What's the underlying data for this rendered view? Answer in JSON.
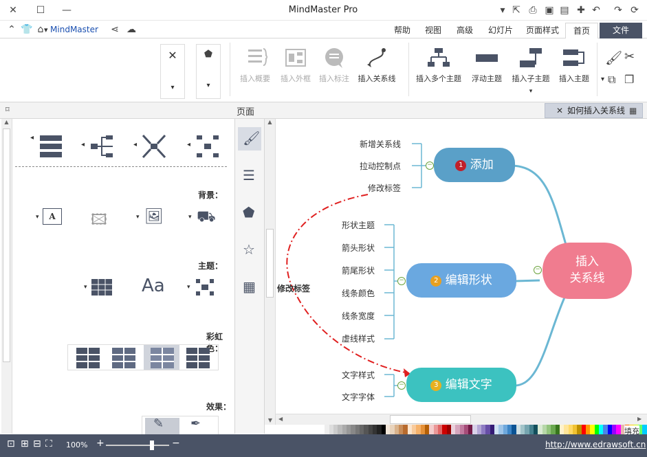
{
  "app": {
    "title": "MindMaster Pro",
    "brand": "MindMaster"
  },
  "tabs": [
    {
      "label": "文件"
    },
    {
      "label": "首页"
    },
    {
      "label": "页面样式"
    },
    {
      "label": "幻灯片"
    },
    {
      "label": "高级"
    },
    {
      "label": "视图"
    },
    {
      "label": "帮助"
    }
  ],
  "ribbon": {
    "insert_topic": "插入主题",
    "insert_subtopic": "插入子主题",
    "floating_topic": "浮动主题",
    "insert_multiple": "插入多个主题",
    "insert_relation": "插入关系线",
    "insert_callout": "插入标注",
    "insert_boundary": "插入外框",
    "insert_summary": "插入概要"
  },
  "pagebar": {
    "label": "页面",
    "doc_tab": "如何插入关系线"
  },
  "left_panel": {
    "sections": {
      "background": "背景：",
      "theme": "主题：",
      "rainbow": "彩虹色：",
      "effect": "效果："
    },
    "theme_font_glyph": "Aa",
    "bg_text_glyph": "A"
  },
  "mindmap": {
    "root": "插入\n关系线",
    "branch1": {
      "num": "1",
      "label": "添加",
      "leaves": [
        "新增关系线",
        "拉动控制点",
        "修改标签"
      ]
    },
    "branch2": {
      "num": "2",
      "label": "编辑形状",
      "leaves": [
        "形状主题",
        "箭头形状",
        "箭尾形状",
        "线条颜色",
        "线条宽度",
        "虚线样式"
      ]
    },
    "branch3": {
      "num": "3",
      "label": "编辑文字",
      "leaves": [
        "文字样式",
        "文字字体"
      ]
    },
    "relation_label": "修改标签"
  },
  "status": {
    "url": "http://www.edrawsoft.cn",
    "zoom": "100%",
    "fill": "填充"
  },
  "colors": {
    "accent": "#4a5366",
    "root": "#f07c8f",
    "branch1": "#5aa0c8",
    "branch2": "#6aa8e0",
    "branch3": "#3cc2c0",
    "line": "#6bb7d3",
    "relation": "#e02020"
  },
  "palette": [
    "#ffffff",
    "#eeeeee",
    "#dddddd",
    "#cccccc",
    "#bbbbbb",
    "#aaaaaa",
    "#999999",
    "#888888",
    "#777777",
    "#666666",
    "#555555",
    "#444444",
    "#333333",
    "#222222",
    "#000000",
    "#f2e6d9",
    "#e8d3bc",
    "#d9b38c",
    "#c98d59",
    "#b86b2e",
    "#fce5cd",
    "#f9cb9c",
    "#f6b26b",
    "#e69138",
    "#b45f06",
    "#f4cccc",
    "#ea9999",
    "#e06666",
    "#cc0000",
    "#990000",
    "#ead1dc",
    "#d5a6bd",
    "#c27ba0",
    "#a64d79",
    "#741b47",
    "#d9d2e9",
    "#b4a7d6",
    "#8e7cc3",
    "#674ea7",
    "#351c75",
    "#cfe2f3",
    "#9fc5e8",
    "#6fa8dc",
    "#3d85c6",
    "#0b5394",
    "#d0e0e3",
    "#a2c4c9",
    "#76a5af",
    "#45818e",
    "#134f5c",
    "#d9ead3",
    "#b6d7a8",
    "#93c47d",
    "#6aa84f",
    "#38761d",
    "#fff2cc",
    "#ffe599",
    "#ffd966",
    "#f1c232",
    "#bf9000",
    "#ff0000",
    "#ff9900",
    "#ffff00",
    "#00ff00",
    "#00ffff",
    "#4a86e8",
    "#0000ff",
    "#9900ff",
    "#ff00ff",
    "#e6b8af",
    "#ff6600",
    "#ffcc00",
    "#ccff00",
    "#66ff66",
    "#00ccff"
  ]
}
